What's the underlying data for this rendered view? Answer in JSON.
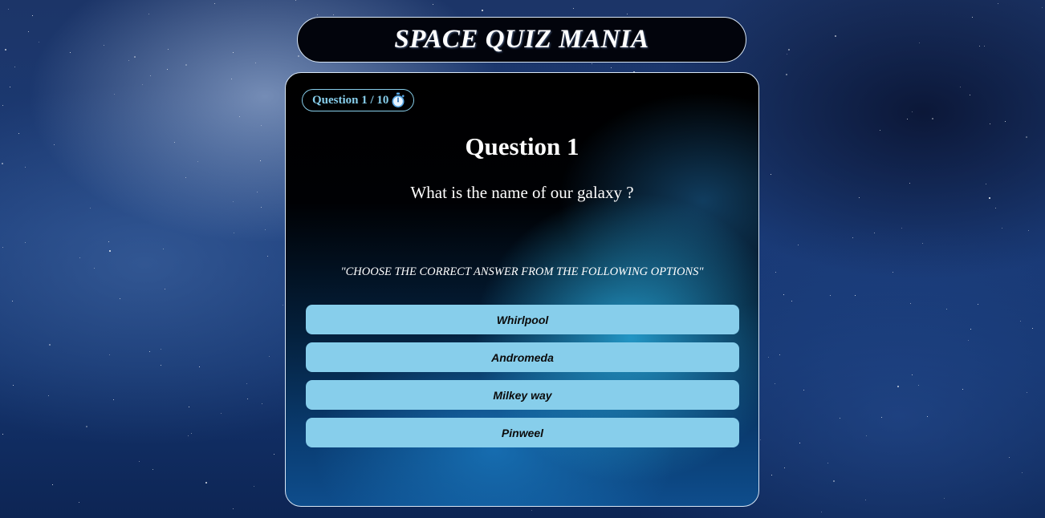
{
  "header": {
    "title": "SPACE QUIZ MANIA"
  },
  "quiz": {
    "counter": "Question 1 / 10",
    "heading": "Question 1",
    "question": "What is the name of our galaxy ?",
    "instruction": "\"CHOOSE THE CORRECT ANSWER FROM THE FOLLOWING OPTIONS\"",
    "options": [
      "Whirlpool",
      "Andromeda",
      "Milkey way",
      "Pinweel"
    ],
    "timer_icon": "stopwatch-icon"
  },
  "colors": {
    "accent": "#87ceeb",
    "border": "#d8e6f5",
    "text": "#ffffff"
  }
}
